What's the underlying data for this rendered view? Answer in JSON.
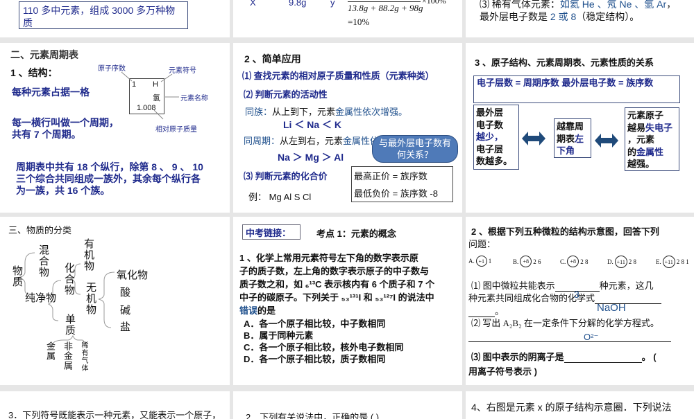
{
  "slides": {
    "s1": {
      "text": "110 多中元素，组成 3000 多万种物质"
    },
    "s2": {
      "x": "X",
      "mass": "9.8g",
      "y": "y",
      "denominator": "13.8g + 88.2g + 98g",
      "times": "×100%",
      "result": "=10%"
    },
    "s3": {
      "line1_pre": "⑶ 稀有气体元素：",
      "line1_blue": "如氦 He 、氖 Ne 、氩 Ar",
      "line1_end": "，",
      "line2_pre": "最外层电子数是 ",
      "line2_blue": "2 或 8",
      "line2_end": "（稳定结构）。"
    },
    "s4": {
      "title": "二、元素周期表",
      "subtitle": "1 、结构：",
      "p1": "每种元素占据一格",
      "p2a": "每一横行叫做一个周期，",
      "p2b": "共有 7 个周期。",
      "p3a": "周期表中共有 18 个纵行，除第 8 、 9 、 10",
      "p3b": "三个综合共同组成一族外，其余每个纵行各",
      "p3c": "为一族，共 16 个族。",
      "cell": {
        "number": "1",
        "symbol": "H",
        "name": "氢",
        "mass": "1.008"
      },
      "labels": {
        "number": "原子序数",
        "symbol": "元素符号",
        "name": "元素名称",
        "mass": "相对原子质量"
      }
    },
    "s5": {
      "title": "2 、简单应用",
      "i1": "⑴ 查找元素的相对原子质量和性质（元素种类）",
      "i2": "⑵ 判断元素的活动性",
      "g1_label": "同族：",
      "g1_text": "从上到下，元素",
      "g1_blue": "金属性依次增强。",
      "g1_ex": "Li ＜ Na ＜ K",
      "g2_label": "同周期：",
      "g2_text": "从左到右，元素",
      "g2_blue": "金属性依次减弱",
      "g2_ex": "Na ＞ Mg  ＞  Al",
      "i3": "⑶ 判断元素的化合价",
      "example": "例：  Mg Al S Cl",
      "rule1": "最高正价 = 族序数",
      "rule2": "最低负价 = 族序数 -8",
      "callout": "与最外层电子数有何关系？"
    },
    "s6": {
      "title": "3 、原子结构、元素周期表、元素性质的关系",
      "top": "电子层数 = 周期序数       最外层电子数 = 族序数",
      "left": [
        "最外层",
        "电子数",
        "越少，",
        "电子层",
        "数越多。"
      ],
      "mid_a": "越靠周",
      "mid_b": "期表",
      "mid_blue": "左",
      "mid_c": "下角",
      "right_a": "元素原子",
      "right_b": "越易",
      "right_blue1": "失电子",
      "right_c": "，元素",
      "right_d": "的",
      "right_blue2": "金属性",
      "right_e": "越强。"
    },
    "s7": {
      "title": "三、物质的分类",
      "root": "物质",
      "mix": "混合物",
      "pure": "纯净物",
      "compound": "化合物",
      "organic": "有机物",
      "inorganic": "无机物",
      "oxide": "氧化物",
      "acid": "酸",
      "base": "碱",
      "salt": "盐",
      "simple": "单质",
      "metal": "金属",
      "nonmetal": "非金属",
      "noble": "稀有气体"
    },
    "s8": {
      "tag": "中考链接：",
      "topic": "考点 1：元素的概念",
      "q1": " 1 、化学上常用元素符号左下角的数字表示原",
      "q2": "子的质子数，左上角的数字表示原子的中子数与",
      "q3": "质子数之和，如 ₆¹³C 表示核内有 6 个质子和 7 个",
      "q4": "中子的碳原子。下列关于 ₅₃¹³¹I 和 ₅₃¹²⁷I 的说法中",
      "q5_blue": "错误",
      "q5": "的是",
      "options": [
        "A．各一个原子相比较，中子数相同",
        "B．属于同种元素",
        "C．各一个原子相比较，核外电子数相同",
        "D．各一个原子相比较，质子数相同"
      ]
    },
    "s9": {
      "title_a": "2 、根据下列五种微粒的结构示意图，回答下列",
      "title_b": "问题：",
      "particles": [
        {
          "label": "A.",
          "core": "+1",
          "shells": "1"
        },
        {
          "label": "B.",
          "core": "+8",
          "shells": "2 6"
        },
        {
          "label": "C.",
          "core": "+8",
          "shells": "2 8"
        },
        {
          "label": "D.",
          "core": "+11",
          "shells": "2 8"
        },
        {
          "label": "E.",
          "core": "+11",
          "shells": "2 8 1"
        }
      ],
      "q1a": "⑴ 图中微粒共能表示",
      "q1b": "种元素，这几",
      "q1c": "种元素共同组成化合物的化学式",
      "q1end": "。",
      "ans1": "3",
      "ans2": "NaOH",
      "q2": "⑵ 写出 A₂B₂ 在一定条件下分解的化学方程式。",
      "ans3": "O²⁻",
      "q3a": "⑶ 图中表示的阴离子是",
      "q3b": "。 (",
      "q3c": "用离子符号表示 )"
    },
    "s10": {
      "text": "3．下列符号既能表示一种元素，又能表示一个原子，"
    },
    "s11": {
      "text": "2．下列有关说法中，正确的是 (     )"
    },
    "s12": {
      "text": "4、右图是元素 x 的原子结构示意圈．下列说法"
    }
  }
}
